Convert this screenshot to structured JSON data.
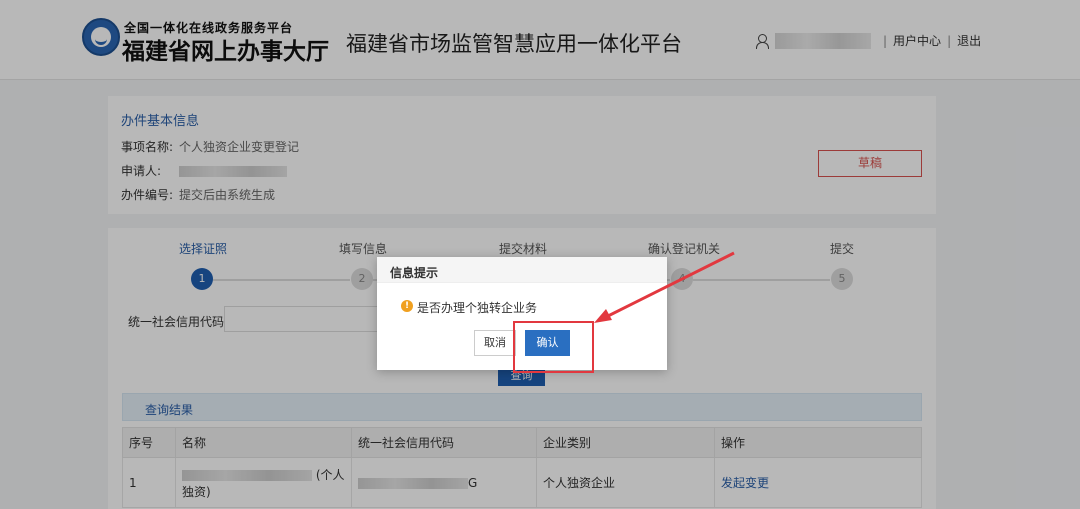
{
  "header": {
    "logo_small": "全国一体化在线政务服务平台",
    "logo_big": "福建省网上办事大厅",
    "platform_title": "福建省市场监管智慧应用一体化平台",
    "user_center": "用户中心",
    "logout": "退出",
    "separator": "|"
  },
  "info": {
    "section_title": "办件基本信息",
    "item_label": "事项名称:",
    "item_value": "个人独资企业变更登记",
    "applicant_label": "申请人:",
    "number_label": "办件编号:",
    "number_value": "提交后由系统生成",
    "draft_button": "草稿"
  },
  "steps": [
    {
      "label": "选择证照",
      "num": "1"
    },
    {
      "label": "填写信息",
      "num": "2"
    },
    {
      "label": "提交材料",
      "num": "3"
    },
    {
      "label": "确认登记机关",
      "num": "4"
    },
    {
      "label": "提交",
      "num": "5"
    }
  ],
  "search": {
    "uscc_label": "统一社会信用代码",
    "query_button": "查询"
  },
  "results": {
    "bar_title": "查询结果",
    "columns": [
      "序号",
      "名称",
      "统一社会信用代码",
      "企业类别",
      "操作"
    ],
    "rows": [
      {
        "index": "1",
        "name_suffix": "(个人独资)",
        "code_suffix": "G",
        "category": "个人独资企业",
        "action": "发起变更"
      }
    ]
  },
  "dialog": {
    "title": "信息提示",
    "message": "是否办理个独转企业务",
    "cancel": "取消",
    "confirm": "确认",
    "warn_glyph": "!"
  },
  "colors": {
    "accent": "#1f5fb0",
    "highlight": "#e2383f",
    "draft": "#d9534f"
  }
}
